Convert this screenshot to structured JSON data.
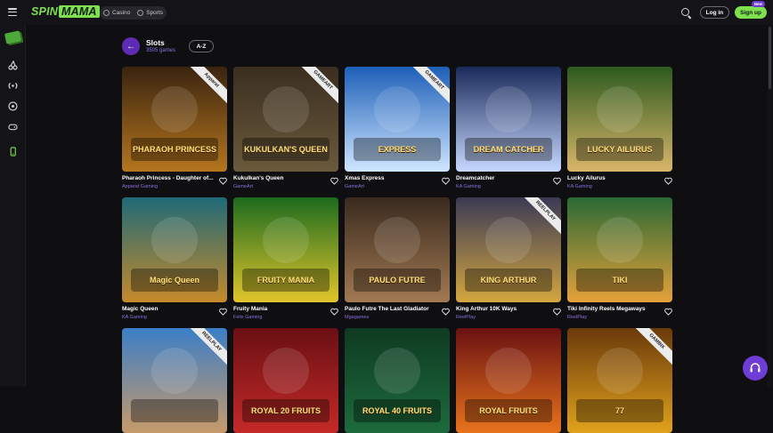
{
  "topbar": {
    "logo_spin": "SPIN",
    "logo_mama": "MAMA",
    "mode": [
      {
        "label": "Casino",
        "icon": "chip-icon"
      },
      {
        "label": "Sports",
        "icon": "soccer-ball-icon"
      }
    ],
    "login_label": "Log in",
    "signup_label": "Sign up",
    "new_badge": "New"
  },
  "header": {
    "title": "Slots",
    "subtitle": "3505 games",
    "sort_label": "A-Z"
  },
  "games": [
    {
      "title": "Pharaoh Princess - Daughter of...",
      "provider": "Apparat Gaming",
      "ribbon": "Apparat",
      "c1": "#3a2410",
      "c2": "#b5761e"
    },
    {
      "title": "Kukulkan's Queen",
      "provider": "GameArt",
      "ribbon": "GAMEART",
      "c1": "#3a2e20",
      "c2": "#6b5a3c"
    },
    {
      "title": "Xmas Express",
      "provider": "GameArt",
      "ribbon": "GAMEART",
      "c1": "#1d5fb8",
      "c2": "#cfe6ff"
    },
    {
      "title": "Dreamcatcher",
      "provider": "KA Gaming",
      "ribbon": "",
      "c1": "#1a2a5a",
      "c2": "#c7d8ff"
    },
    {
      "title": "Lucky Ailurus",
      "provider": "KA Gaming",
      "ribbon": "",
      "c1": "#2d5a1e",
      "c2": "#d9b66a"
    },
    {
      "title": "Magic Queen",
      "provider": "KA Gaming",
      "ribbon": "",
      "c1": "#1f6a78",
      "c2": "#c68a2a"
    },
    {
      "title": "Fruity Mania",
      "provider": "Felix Gaming",
      "ribbon": "",
      "c1": "#1c6b1e",
      "c2": "#e1c52c"
    },
    {
      "title": "Paulo Futre The Last Gladiator",
      "provider": "Mgagames",
      "ribbon": "",
      "c1": "#3a2a1f",
      "c2": "#a27a52"
    },
    {
      "title": "King Arthur 10K Ways",
      "provider": "ReelPlay",
      "ribbon": "REELPLAY",
      "c1": "#3a3a55",
      "c2": "#d4a640"
    },
    {
      "title": "Tiki Infinity Reels Megaways",
      "provider": "ReelPlay",
      "ribbon": "",
      "c1": "#2a6a35",
      "c2": "#e6a13a"
    },
    {
      "title": "",
      "provider": "",
      "ribbon": "REELPLAY",
      "c1": "#3b7ec7",
      "c2": "#c79a6a"
    },
    {
      "title": "",
      "provider": "",
      "ribbon": "",
      "c1": "#6a0f14",
      "c2": "#c42a28"
    },
    {
      "title": "",
      "provider": "",
      "ribbon": "",
      "c1": "#0f3a22",
      "c2": "#1d6b3c"
    },
    {
      "title": "",
      "provider": "",
      "ribbon": "",
      "c1": "#6a1212",
      "c2": "#e8731c"
    },
    {
      "title": "",
      "provider": "",
      "ribbon": "GAMBIX",
      "c1": "#6a3a0a",
      "c2": "#e2a21d"
    }
  ],
  "thumb_texts": [
    "PHARAOH PRINCESS",
    "KUKULKAN'S QUEEN",
    "EXPRESS",
    "DREAM CATCHER",
    "LUCKY AILURUS",
    "Magic Queen",
    "FRUITY MANIA",
    "PAULO FUTRE",
    "KING ARTHUR",
    "TIKI",
    "",
    "ROYAL 20 FRUITS",
    "ROYAL 40 FRUITS",
    "ROYAL FRUITS",
    "77"
  ]
}
